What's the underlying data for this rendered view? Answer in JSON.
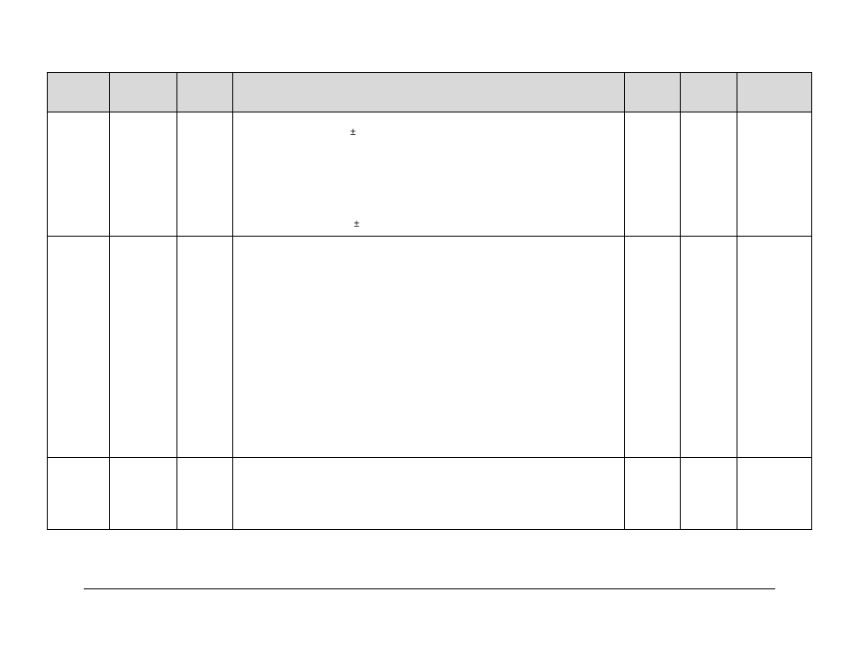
{
  "table": {
    "headers": [
      "",
      "",
      "",
      "",
      "",
      "",
      ""
    ],
    "rows": [
      {
        "cells": [
          "",
          "",
          "",
          "",
          "",
          "",
          ""
        ],
        "symbols": [
          "±",
          "±"
        ]
      },
      {
        "cells": [
          "",
          "",
          "",
          "",
          "",
          "",
          ""
        ]
      },
      {
        "cells": [
          "",
          "",
          "",
          "",
          "",
          "",
          ""
        ]
      }
    ]
  }
}
